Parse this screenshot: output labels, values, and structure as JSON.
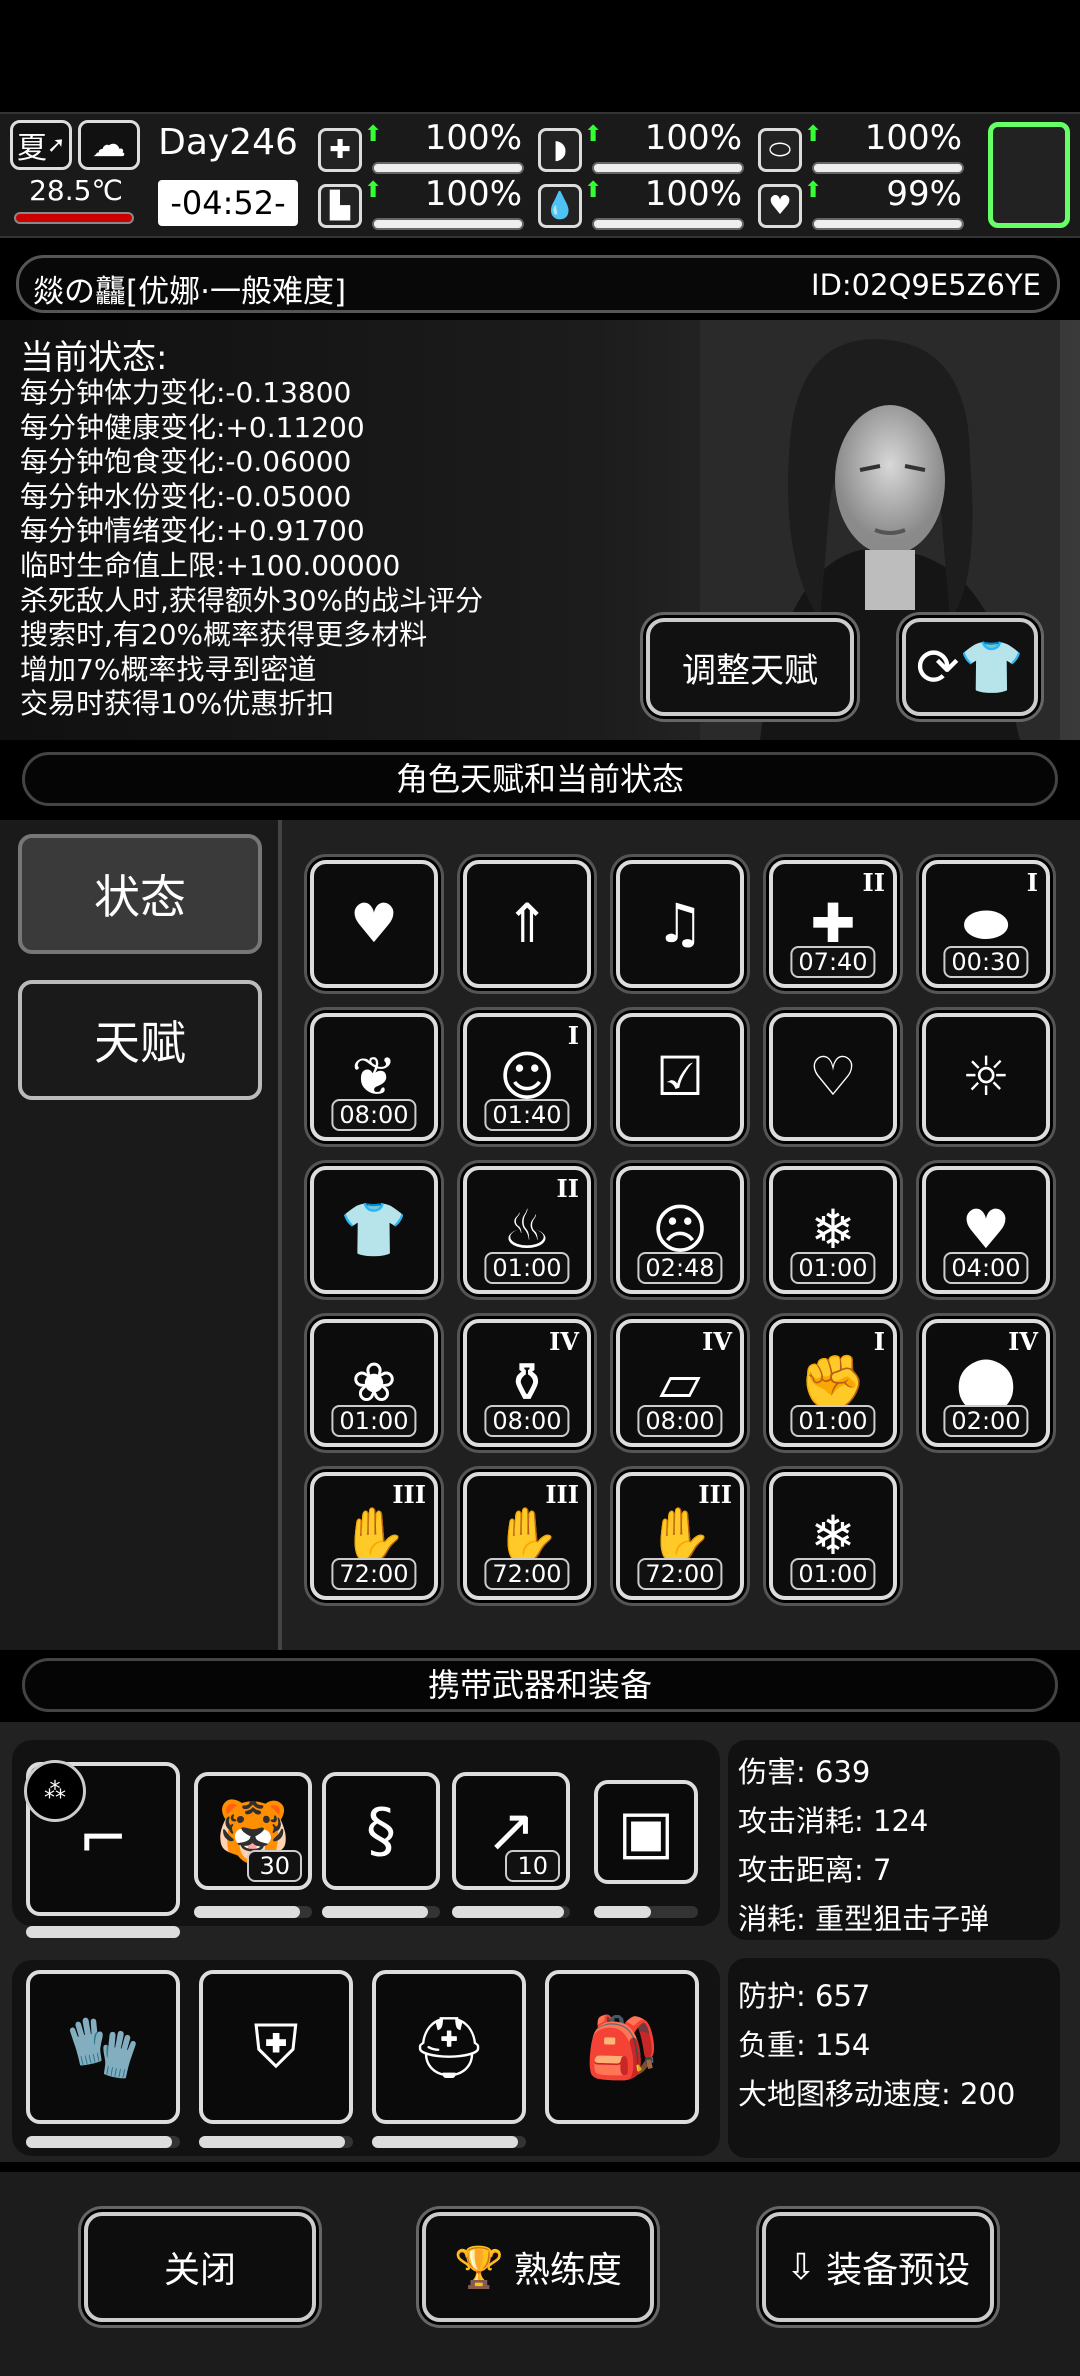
{
  "hud": {
    "season": "夏",
    "temperature": "28.5℃",
    "day": "Day246",
    "clock": "-04:52-",
    "stats": [
      {
        "icon": "medkit-icon",
        "glyph": "✚",
        "value": "100%",
        "level": 1.0
      },
      {
        "icon": "stomach-icon",
        "glyph": "◗",
        "value": "100%",
        "level": 1.0
      },
      {
        "icon": "pill-icon",
        "glyph": "⬭",
        "value": "100%",
        "level": 1.0
      },
      {
        "icon": "boot-icon",
        "glyph": "▙",
        "value": "100%",
        "level": 1.0
      },
      {
        "icon": "water-drop-icon",
        "glyph": "💧",
        "value": "100%",
        "level": 1.0
      },
      {
        "icon": "heart-icon",
        "glyph": "♥",
        "value": "99%",
        "level": 0.99
      }
    ]
  },
  "character": {
    "name": "燚の龘[优娜·一般难度]",
    "id": "ID:02Q9E5Z6YE",
    "status_title": "当前状态:",
    "lines": [
      "每分钟体力变化:-0.13800",
      "每分钟健康变化:+0.11200",
      "每分钟饱食变化:-0.06000",
      "每分钟水份变化:-0.05000",
      "每分钟情绪变化:+0.91700",
      "临时生命值上限:+100.00000",
      "杀死敌人时,获得额外30%的战斗评分",
      "搜索时,有20%概率获得更多材料",
      "增加7%概率找寻到密道",
      "交易时获得10%优惠折扣"
    ],
    "adjust_talent": "调整天赋"
  },
  "section1": "角色天赋和当前状态",
  "tabs": {
    "status": "状态",
    "talent": "天赋"
  },
  "buffs": [
    {
      "icon": "heart-icon",
      "glyph": "♥",
      "timer": "",
      "rank": ""
    },
    {
      "icon": "stomach-boost-icon",
      "glyph": "⇑",
      "timer": "",
      "rank": ""
    },
    {
      "icon": "music-heart-icon",
      "glyph": "♫",
      "timer": "",
      "rank": ""
    },
    {
      "icon": "medkit-up-icon",
      "glyph": "✚",
      "timer": "07:40",
      "rank": "II"
    },
    {
      "icon": "pill-icon",
      "glyph": "⬬",
      "timer": "00:30",
      "rank": "I"
    },
    {
      "icon": "leaf-up-icon",
      "glyph": "❦",
      "timer": "08:00",
      "rank": ""
    },
    {
      "icon": "happy-face-icon",
      "glyph": "☺",
      "timer": "01:40",
      "rank": "I"
    },
    {
      "icon": "prescription-icon",
      "glyph": "☑",
      "timer": "",
      "rank": ""
    },
    {
      "icon": "stomach-heart-icon",
      "glyph": "♡",
      "timer": "",
      "rank": ""
    },
    {
      "icon": "alarm-icon",
      "glyph": "☼",
      "timer": "",
      "rank": ""
    },
    {
      "icon": "shirt-icon",
      "glyph": "👕",
      "timer": "",
      "rank": ""
    },
    {
      "icon": "hot-food-icon",
      "glyph": "♨",
      "timer": "01:00",
      "rank": "II"
    },
    {
      "icon": "sleep-icon",
      "glyph": "☹",
      "timer": "02:48",
      "rank": ""
    },
    {
      "icon": "cold-food-icon",
      "glyph": "❄",
      "timer": "01:00",
      "rank": ""
    },
    {
      "icon": "meal-icon",
      "glyph": "♥",
      "timer": "04:00",
      "rank": ""
    },
    {
      "icon": "candy-icon",
      "glyph": "❀",
      "timer": "01:00",
      "rank": ""
    },
    {
      "icon": "bottle-up-icon",
      "glyph": "⚱",
      "timer": "08:00",
      "rank": "IV"
    },
    {
      "icon": "bandage-up-icon",
      "glyph": "▱",
      "timer": "08:00",
      "rank": "IV"
    },
    {
      "icon": "fist-up-icon",
      "glyph": "✊",
      "timer": "01:00",
      "rank": "I"
    },
    {
      "icon": "food-up-icon",
      "glyph": "⬤",
      "timer": "02:00",
      "rank": "IV"
    },
    {
      "icon": "hand-icon",
      "glyph": "✋",
      "timer": "72:00",
      "rank": "III"
    },
    {
      "icon": "hand-icon",
      "glyph": "✋",
      "timer": "72:00",
      "rank": "III"
    },
    {
      "icon": "hand-icon",
      "glyph": "✋",
      "timer": "72:00",
      "rank": "III"
    },
    {
      "icon": "ice-pack-icon",
      "glyph": "❄",
      "timer": "01:00",
      "rank": ""
    }
  ],
  "section2": "携带武器和装备",
  "weapons": [
    {
      "icon": "sniper-rifle-icon",
      "glyph": "⌐",
      "count": "",
      "durability": 1.0
    },
    {
      "icon": "tiger-grenade-icon",
      "glyph": "🐯",
      "count": "30",
      "durability": 0.9
    },
    {
      "icon": "chain-whip-icon",
      "glyph": "§",
      "count": "",
      "durability": 0.9
    },
    {
      "icon": "spear-rifle-icon",
      "glyph": "↗",
      "count": "10",
      "durability": 0.95
    },
    {
      "icon": "shield-card-icon",
      "glyph": "▣",
      "count": "",
      "durability": 0.55
    }
  ],
  "weapon_stats": [
    "伤害: 639",
    "攻击消耗: 124",
    "攻击距离: 7",
    "消耗: 重型狙击子弹"
  ],
  "armor": [
    {
      "icon": "gloves-icon",
      "glyph": "🧤",
      "durability": 0.95
    },
    {
      "icon": "body-armor-icon",
      "glyph": "⛨",
      "durability": 0.95
    },
    {
      "icon": "helmet-icon",
      "glyph": "⛑",
      "durability": 0.95
    },
    {
      "icon": "backpack-icon",
      "glyph": "🎒",
      "durability": 1.0
    }
  ],
  "armor_stats": [
    "防护: 657",
    "负重: 154",
    "大地图移动速度: 200"
  ],
  "buttons": {
    "close": "关闭",
    "proficiency": "熟练度",
    "preset": "装备预设"
  }
}
